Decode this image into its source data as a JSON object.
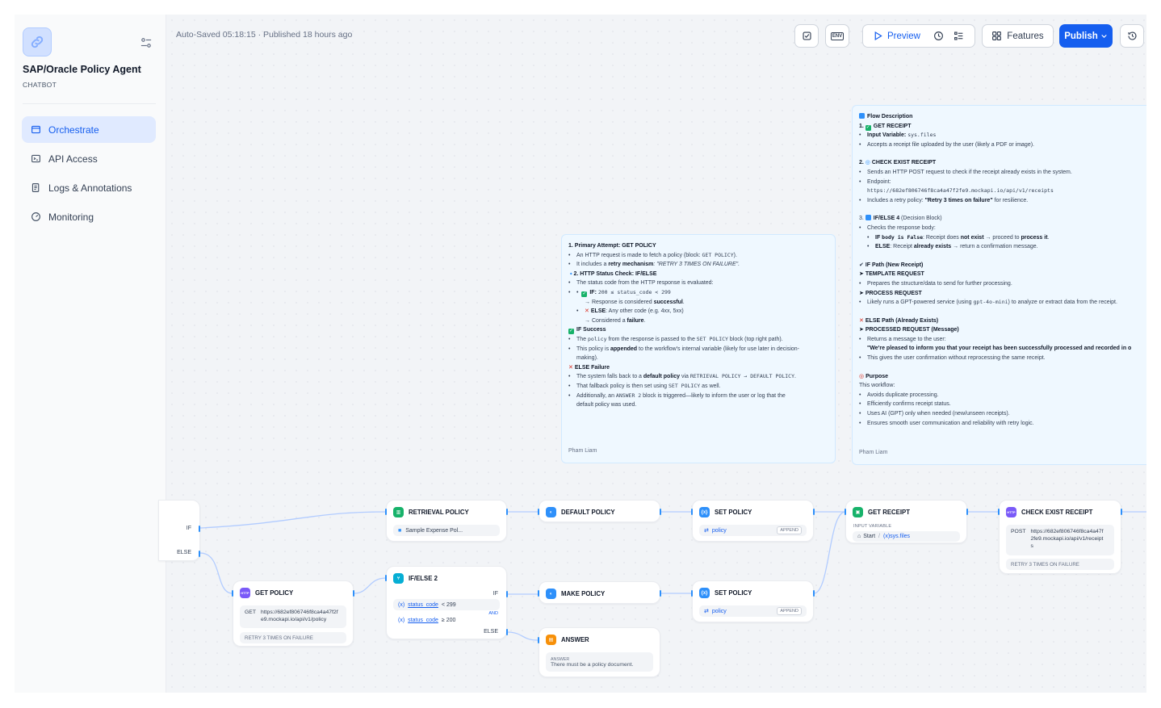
{
  "app": {
    "name": "SAP/Oracle Policy Agent",
    "type": "CHATBOT"
  },
  "nav": {
    "items": [
      {
        "label": "Orchestrate",
        "icon": "window-icon",
        "active": true
      },
      {
        "label": "API Access",
        "icon": "terminal-icon",
        "active": false
      },
      {
        "label": "Logs & Annotations",
        "icon": "file-list-icon",
        "active": false
      },
      {
        "label": "Monitoring",
        "icon": "dashboard-icon",
        "active": false
      }
    ]
  },
  "toolbar": {
    "autosave": "Auto-Saved 05:18:15 · Published 18 hours ago",
    "preview": "Preview",
    "features": "Features",
    "publish": "Publish",
    "env_label": "ENV"
  },
  "colors": {
    "accent": "#155eef",
    "active_bg": "#e0eaff",
    "canvas": "#f2f4f7",
    "note_bg": "#eff8ff"
  },
  "note_left": {
    "l1": "1. Primary Attempt: GET POLICY",
    "l2a": "An HTTP request is made to fetch a policy (block: ",
    "l2b": "GET POLICY",
    "l2c": ").",
    "l3a": "It includes a ",
    "l3b": "retry mechanism",
    "l3c": ": \"RETRY 3 TIMES ON FAILURE\".",
    "l4": "2. HTTP Status Check: IF/ELSE",
    "l5": "The status code from the HTTP response is evaluated:",
    "l6a": "IF: ",
    "l6b": "200 ≤ status_code < 299",
    "l7a": "→ Response is considered ",
    "l7b": "successful",
    "l7c": ".",
    "l8a": "ELSE",
    "l8b": ": Any other code (e.g. 4xx, 5xx)",
    "l9a": "→ Considered a ",
    "l9b": "failure",
    "l9c": ".",
    "l10": "IF Success",
    "l11a": "The ",
    "l11b": "policy",
    "l11c": " from the response is passed to the ",
    "l11d": "SET POLICY",
    "l11e": " block (top right path).",
    "l12a": "This policy is ",
    "l12b": "appended",
    "l12c": " to the workflow's internal variable (likely for use later in decision-",
    "l12d": "making).",
    "l13": "ELSE Failure",
    "l14a": "The system falls back to a ",
    "l14b": "default policy",
    "l14c": " via ",
    "l14d": "RETRIEVAL POLICY → DEFAULT POLICY",
    "l14e": ".",
    "l15a": "That fallback policy is then set using ",
    "l15b": "SET POLICY",
    "l15c": " as well.",
    "l16a": "Additionally, an ",
    "l16b": "ANSWER 2",
    "l16c": " block is triggered—likely to inform the user or log that the",
    "l16d": "default policy was used.",
    "author": "Pham Liam"
  },
  "note_right": {
    "r1": "Flow Description",
    "r2": "1. ",
    "r2b": "GET RECEIPT",
    "r3a": "Input Variable: ",
    "r3b": "sys.files",
    "r4": "Accepts a receipt file uploaded by the user (likely a PDF or image).",
    "r5a": "2. ",
    "r5b": "CHECK EXIST RECEIPT",
    "r6": "Sends an HTTP POST request to check if the receipt already exists in the system.",
    "r7": "Endpoint:",
    "r8": "https://682ef806746f8ca4a47f2fe9.mockapi.io/api/v1/receipts",
    "r9a": "Includes a retry policy: ",
    "r9b": "\"Retry 3 times on failure\"",
    "r9c": " for resilience.",
    "r10a": "3. ",
    "r10b": "IF/ELSE 4",
    "r10c": " (Decision Block)",
    "r11": "Checks the response body:",
    "r12a": "IF ",
    "r12b": "body is False",
    "r12c": ": Receipt does ",
    "r12d": "not exist",
    "r12e": " → proceed to ",
    "r12f": "process it",
    "r12g": ".",
    "r13a": "ELSE",
    "r13b": ": Receipt ",
    "r13c": "already exists",
    "r13d": " → return a confirmation message.",
    "r14": "IF Path (New Receipt)",
    "r15": "TEMPLATE REQUEST",
    "r16": "Prepares the structure/data to send for further processing.",
    "r17": "PROCESS REQUEST",
    "r18a": "Likely runs a GPT-powered service (using ",
    "r18b": "gpt-4o-mini",
    "r18c": ") to analyze or extract data from the receipt.",
    "r19": "ELSE Path (Already Exists)",
    "r20": "PROCESSED REQUEST (Message)",
    "r21": "Returns a message to the user:",
    "r22": "\"We're pleased to inform you that your receipt has been successfully processed and recorded in o",
    "r23": "This gives the user confirmation without reprocessing the same receipt.",
    "r24": "Purpose",
    "r25": "This workflow:",
    "r26": "Avoids duplicate processing.",
    "r27": "Efficiently confirms receipt status.",
    "r28": "Uses AI (GPT) only when needed (new/unseen receipts).",
    "r29": "Ensures smooth user communication and reliability with retry logic.",
    "author": "Pham Liam"
  },
  "nodes": {
    "ifelse_left": {
      "if": "IF",
      "else": "ELSE"
    },
    "retrieval": {
      "title": "RETRIEVAL POLICY",
      "value": "Sample Expense Pol..."
    },
    "default_policy": {
      "title": "DEFAULT POLICY"
    },
    "set_policy_1": {
      "title": "SET POLICY",
      "var": "policy",
      "tag": "APPEND"
    },
    "get_receipt": {
      "title": "GET RECEIPT",
      "label": "INPUT VARIABLE",
      "start": "Start",
      "var": "sys.files"
    },
    "check_receipt": {
      "title": "CHECK EXIST RECEIPT",
      "method": "POST",
      "url1": "https://682ef806746f8ca4a47f",
      "url2": "2fe9.mockapi.io/api/v1/receipt",
      "url3": "s",
      "retry": "RETRY 3 TIMES ON FAILURE"
    },
    "get_policy": {
      "title": "GET POLICY",
      "method": "GET",
      "url1": "https://682ef806746f8ca4a47f2f",
      "url2": "e9.mockapi.io/api/v1/policy",
      "retry": "RETRY 3 TIMES ON FAILURE"
    },
    "ifelse2": {
      "title": "IF/ELSE 2",
      "if": "IF",
      "cond1": "status_code",
      "op1": "< 299",
      "and": "AND",
      "cond2": "status_code",
      "op2": "≥ 200",
      "else": "ELSE"
    },
    "make_policy": {
      "title": "MAKE POLICY"
    },
    "set_policy_2": {
      "title": "SET POLICY",
      "var": "policy",
      "tag": "APPEND"
    },
    "answer": {
      "title": "ANSWER",
      "label": "ANSWER",
      "text": "There must be a policy document."
    }
  },
  "badges": {
    "http": "HTTP"
  }
}
